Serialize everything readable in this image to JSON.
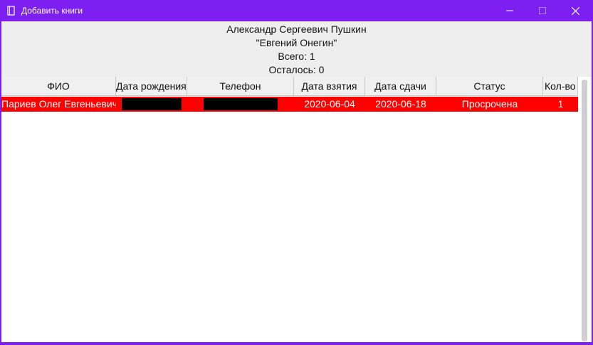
{
  "window": {
    "title": "Добавить книги",
    "accent": "#7c1ff0",
    "icons": {
      "app": "book-icon",
      "minimize": "minimize-icon",
      "maximize": "maximize-icon",
      "close": "close-icon"
    }
  },
  "info": {
    "author": "Александр Сергеевич Пушкин",
    "book": "\"Евгений Онегин\"",
    "total": "Всего: 1",
    "remaining": "Осталось: 0"
  },
  "table": {
    "columns": [
      "ФИО",
      "Дата рождения",
      "Телефон",
      "Дата взятия",
      "Дата сдачи",
      "Статус",
      "Кол-во"
    ],
    "rows": [
      {
        "fio": "Париев Олег Евгеньевич",
        "birth_date": "",
        "phone": "",
        "taken": "2020-06-04",
        "returned": "2020-06-18",
        "status": "Просрочена",
        "count": "1",
        "row_color": "#ff0000"
      }
    ]
  }
}
